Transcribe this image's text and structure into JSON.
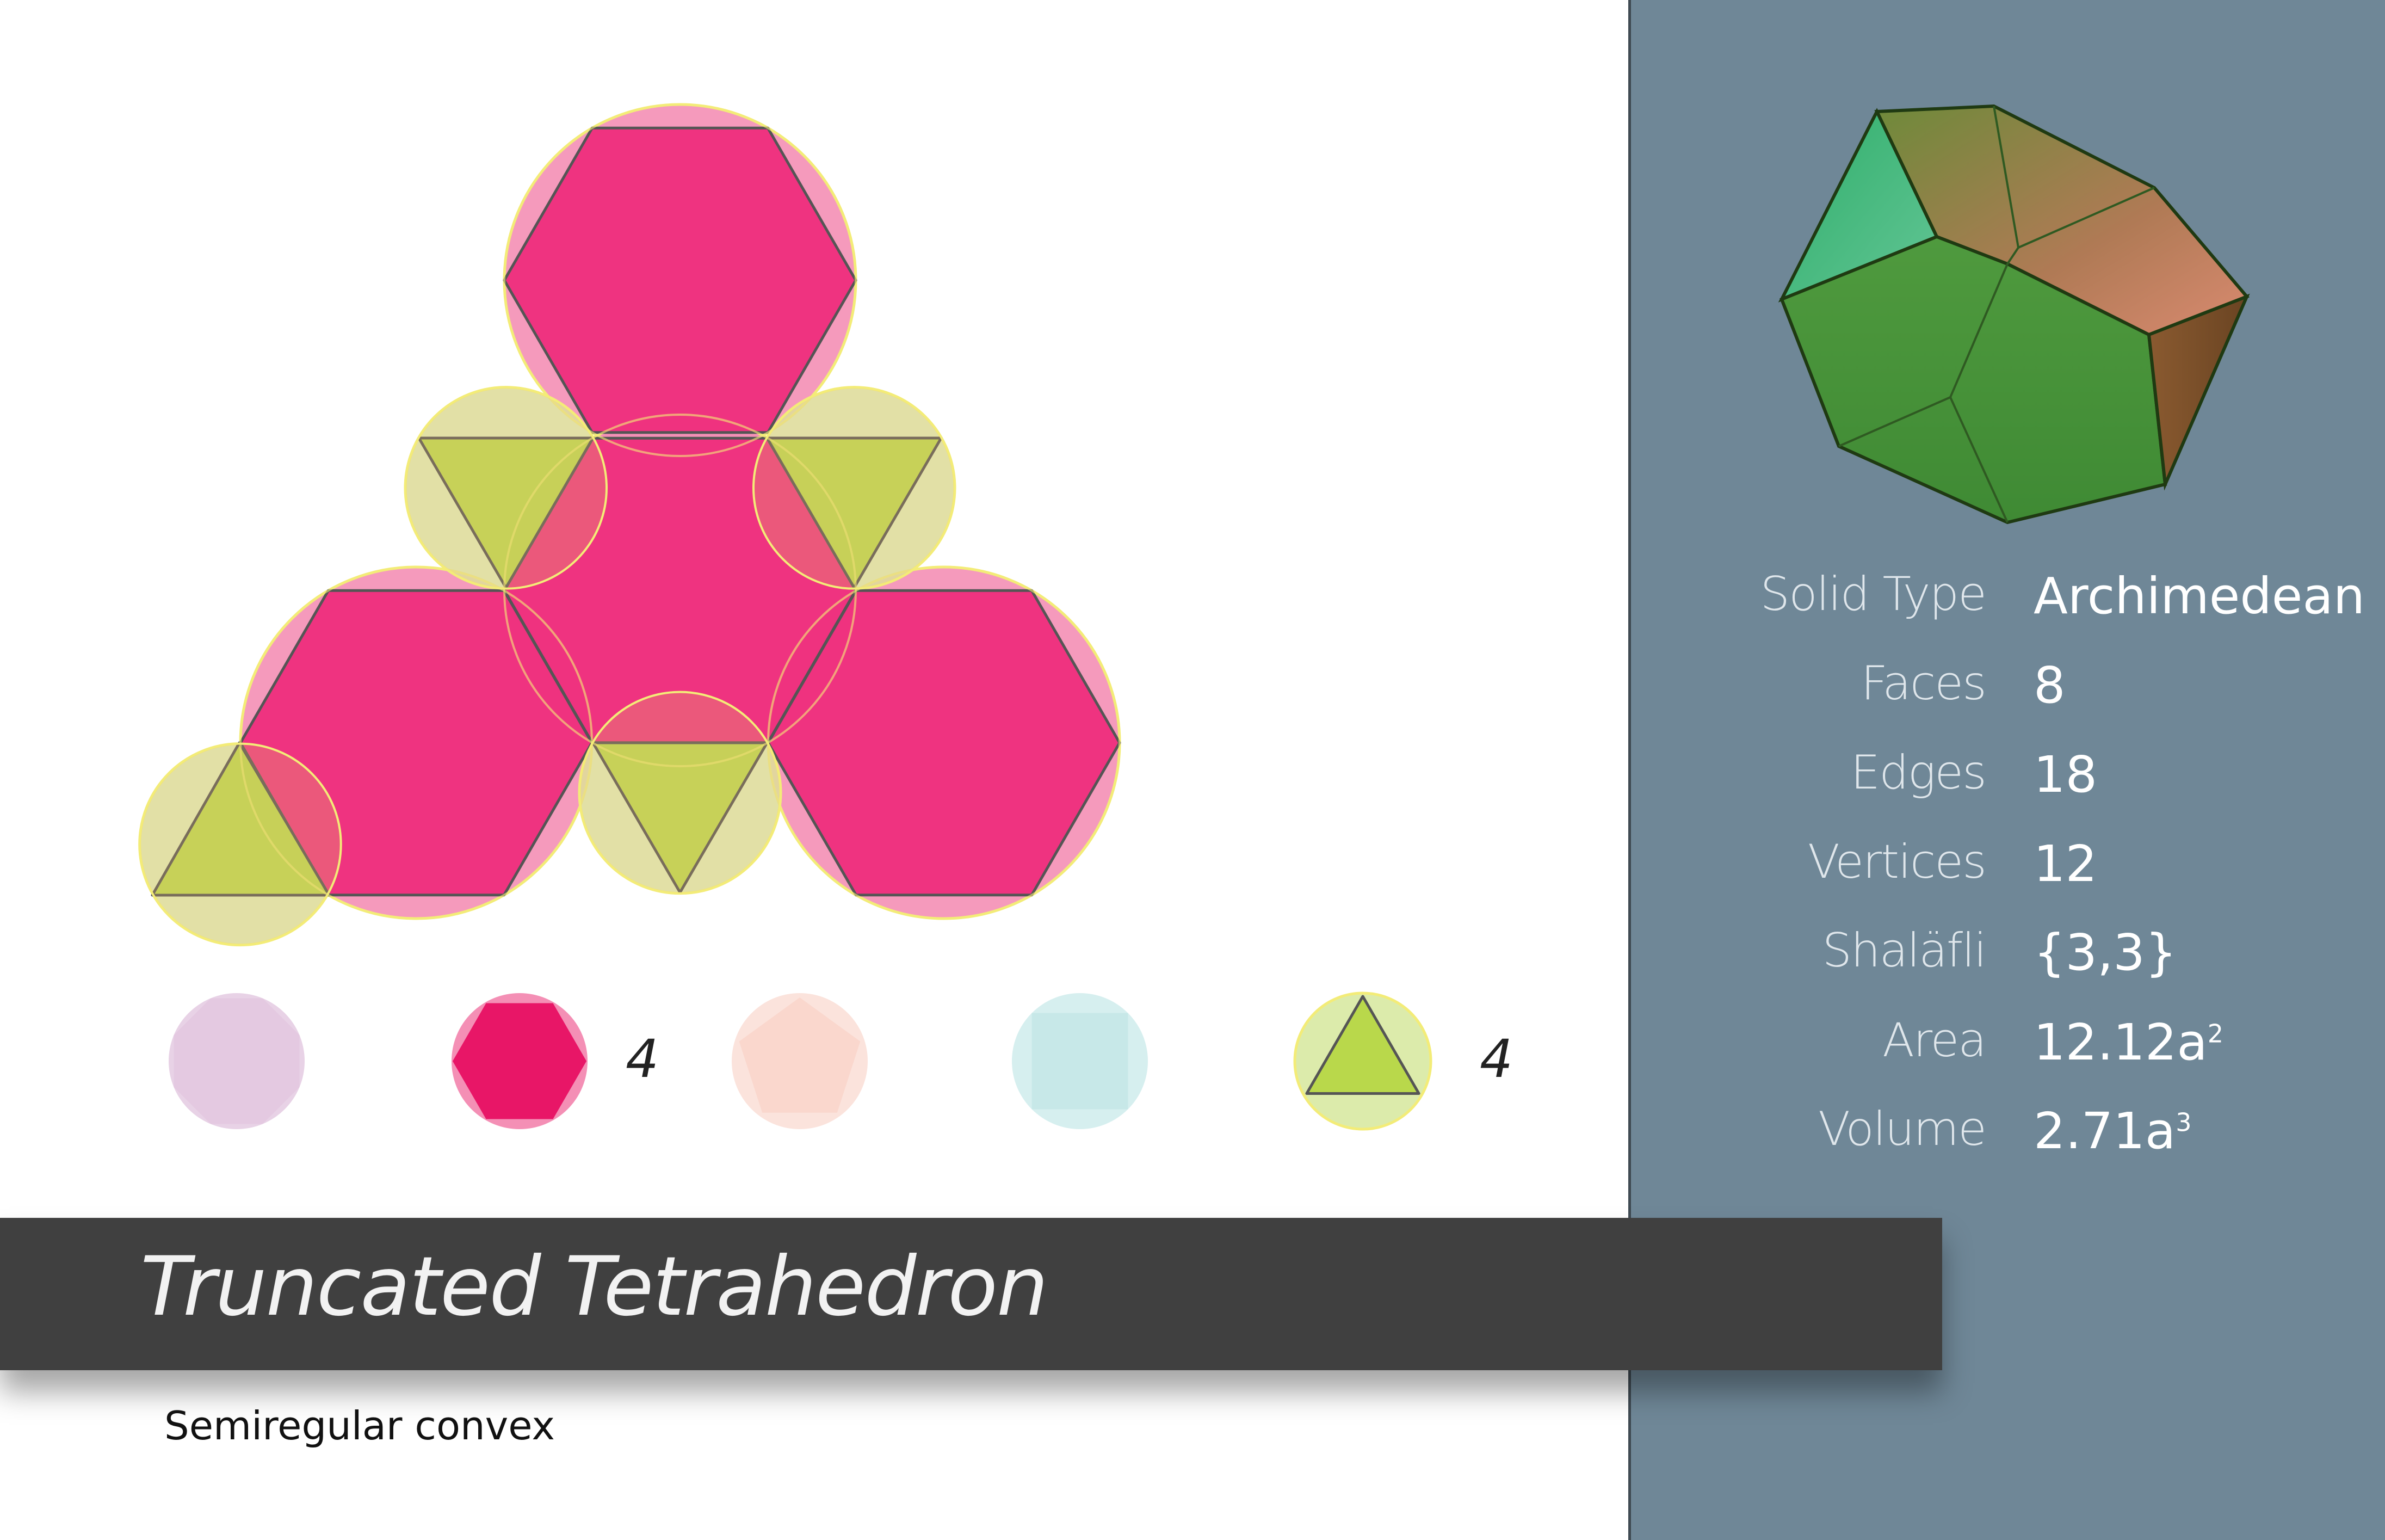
{
  "title": "Truncated Tetrahedron",
  "subtitle": "Semiregular convex",
  "properties": [
    {
      "label": "Solid Type",
      "value": "Archimedean"
    },
    {
      "label": "Faces",
      "value": "8"
    },
    {
      "label": "Edges",
      "value": "18"
    },
    {
      "label": "Vertices",
      "value": "12"
    },
    {
      "label": "Shaläfli",
      "value": "{3,3}"
    },
    {
      "label": "Area",
      "value": "12.12a",
      "sup": "2"
    },
    {
      "label": "Volume",
      "value": "2.71a",
      "sup": "3"
    }
  ],
  "face_legend": [
    {
      "shape": "octagon",
      "count": ""
    },
    {
      "shape": "hexagon",
      "count": "4"
    },
    {
      "shape": "pentagon",
      "count": ""
    },
    {
      "shape": "square",
      "count": ""
    },
    {
      "shape": "triangle",
      "count": "4"
    }
  ],
  "colors": {
    "hexagon": "#ee2a7b",
    "hexagon_circle": "#f48fb5",
    "triangle": "#b9d84b",
    "triangle_circle": "#dcebab",
    "panel": "#6f8797",
    "title_bar": "#404040"
  }
}
